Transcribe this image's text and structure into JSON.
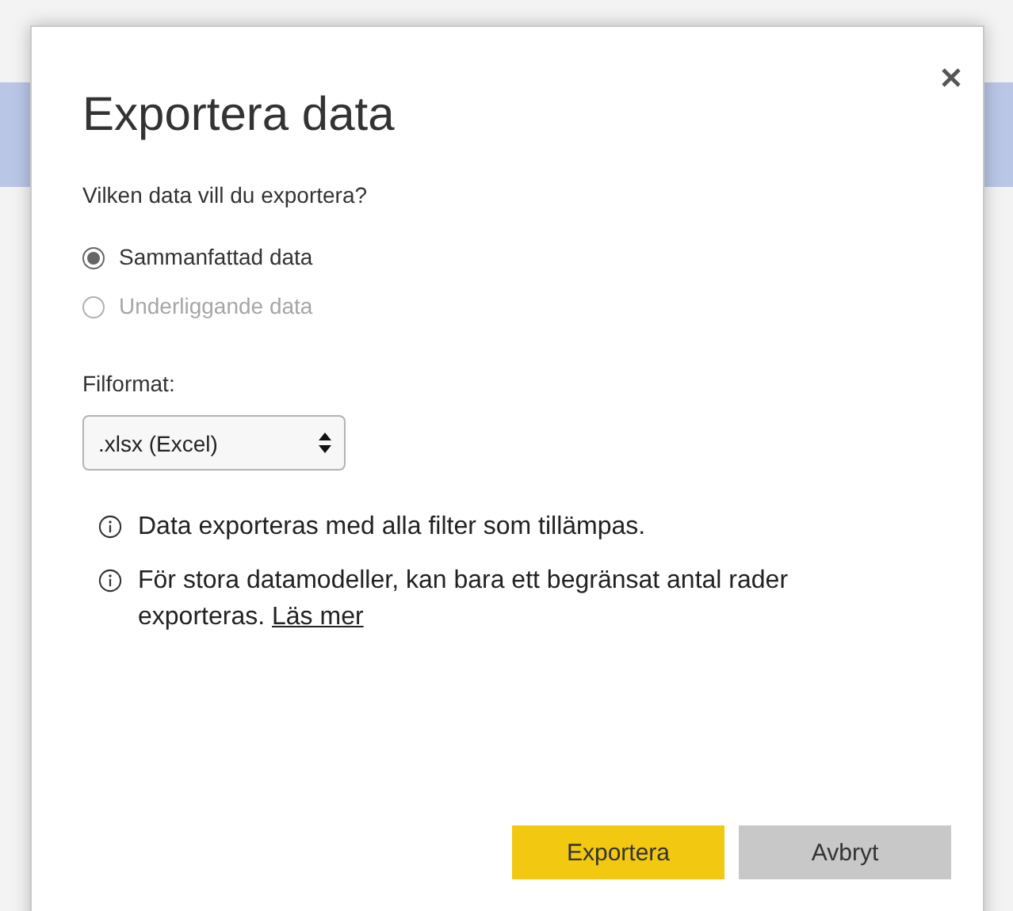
{
  "dialog": {
    "title": "Exportera data",
    "question": "Vilken data vill du exportera?",
    "options": [
      {
        "label": "Sammanfattad data",
        "selected": true,
        "disabled": false
      },
      {
        "label": "Underliggande data",
        "selected": false,
        "disabled": true
      }
    ],
    "format": {
      "label": "Filformat:",
      "value": ".xlsx (Excel)"
    },
    "notes": [
      {
        "text": "Data exporteras med alla filter som tillämpas."
      },
      {
        "text": "För stora datamodeller, kan bara ett begränsat antal rader exporteras.",
        "link": "Läs mer"
      }
    ],
    "buttons": [
      {
        "label": "Exportera",
        "kind": "primary"
      },
      {
        "label": "Avbryt",
        "kind": "secondary"
      }
    ]
  }
}
